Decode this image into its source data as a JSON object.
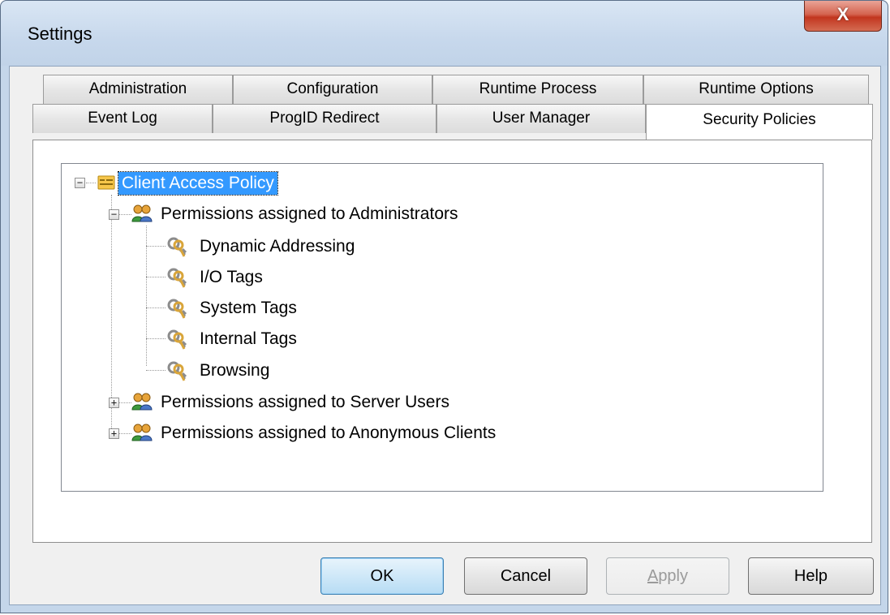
{
  "window": {
    "title": "Settings",
    "close_glyph": "X"
  },
  "tabs": {
    "row1": [
      "Administration",
      "Configuration",
      "Runtime Process",
      "Runtime Options"
    ],
    "row2": [
      "Event Log",
      "ProgID Redirect",
      "User Manager",
      "Security Policies"
    ],
    "active": "Security Policies"
  },
  "tree": {
    "root": {
      "label": "Client Access Policy",
      "icon": "policy-icon",
      "expanded": true,
      "selected": true
    },
    "groups": [
      {
        "label": "Permissions assigned to Administrators",
        "icon": "users-icon",
        "expanded": true,
        "children": [
          "Dynamic Addressing",
          "I/O Tags",
          "System Tags",
          "Internal Tags",
          "Browsing"
        ]
      },
      {
        "label": "Permissions assigned to Server Users",
        "icon": "users-icon",
        "expanded": false
      },
      {
        "label": "Permissions assigned to Anonymous Clients",
        "icon": "users-icon",
        "expanded": false
      }
    ],
    "child_icon": "keys-icon"
  },
  "buttons": {
    "ok": "OK",
    "cancel": "Cancel",
    "apply_mnemonic": "A",
    "apply_rest": "pply",
    "help": "Help"
  },
  "colors": {
    "selection": "#3399ff",
    "title_bar": "#c4d6ea",
    "close_button": "#c2361f"
  }
}
